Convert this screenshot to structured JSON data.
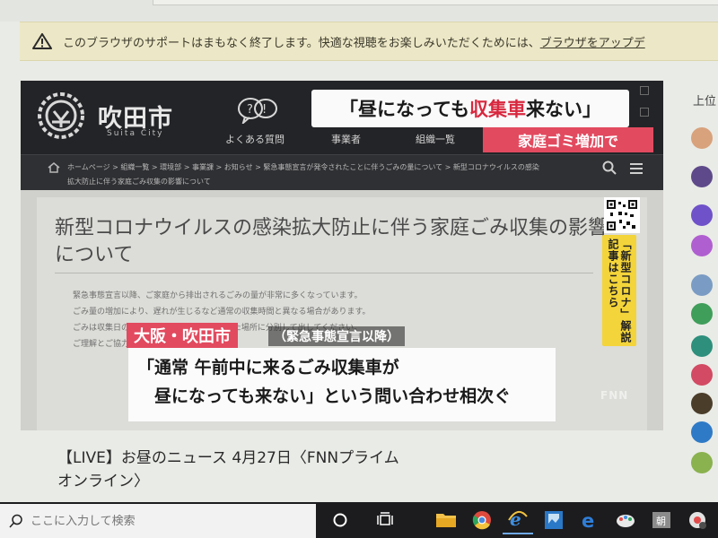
{
  "browser_warning": {
    "message": "このブラウザのサポートはまもなく終了します。快適な視聴をお楽しみいただくためには、",
    "link": "ブラウザをアップデ"
  },
  "site": {
    "name": "吹田市",
    "name_en": "Suita City",
    "nav": [
      "よくある質問",
      "事業者",
      "組織一覧"
    ],
    "breadcrumb_line1": "ホームページ > 組織一覧 > 環境部 > 事業課 > お知らせ > 緊急事態宣言が発令されたことに伴うごみの量について > 新型コロナウイルスの感染",
    "breadcrumb_line2": "拡大防止に伴う家庭ごみ収集の影響について"
  },
  "article": {
    "title": "新型コロナウイルスの感染拡大防止に伴う家庭ごみ収集の影響について",
    "body_lines": [
      "緊急事態宣言以降、ご家庭から排出されるごみの量が非常に多くなっています。",
      "ごみ量の増加により、遅れが生じるなど通常の収集時間と異なる場合があります。",
      "ごみは収集日の朝8時30分までに、決められた場所に分別して出してください。",
      "ご理解とご協力をお願いします。"
    ]
  },
  "telop": {
    "headline_pre": "「昼になっても",
    "headline_hl": "収集車",
    "headline_post": "来ない」",
    "tag": "家庭ゴミ増加で",
    "location": "大阪・吹田市",
    "location_note": "（緊急事態宣言以降）",
    "quote": "「通常 午前中に来るごみ収集車が\n　昼になっても来ない」という問い合わせ相次ぐ",
    "side_banner": "「新型コロナ」解説記事はこちら",
    "watermark": "FNN"
  },
  "video_title": "【LIVE】お昼のニュース 4月27日〈FNNプライム\nオンライン〉",
  "right_panel": {
    "title": "上位",
    "avatars": [
      "#d8a27c",
      "#5e4a8a",
      "#6f52c9",
      "#b05fd0",
      "#7a9cc4",
      "#3f9e5a",
      "#2d8f7c",
      "#d24a63",
      "#4a3d2a",
      "#2f7ac7",
      "#8ab24f"
    ]
  },
  "taskbar": {
    "search_placeholder": "ここに入力して検索",
    "apps": [
      "cortana-icon",
      "task-view-icon",
      "file-explorer-icon",
      "chrome-icon",
      "internet-explorer-icon",
      "photo-app-icon",
      "edge-icon",
      "paint-icon",
      "news-app-icon",
      "media-icon"
    ]
  }
}
